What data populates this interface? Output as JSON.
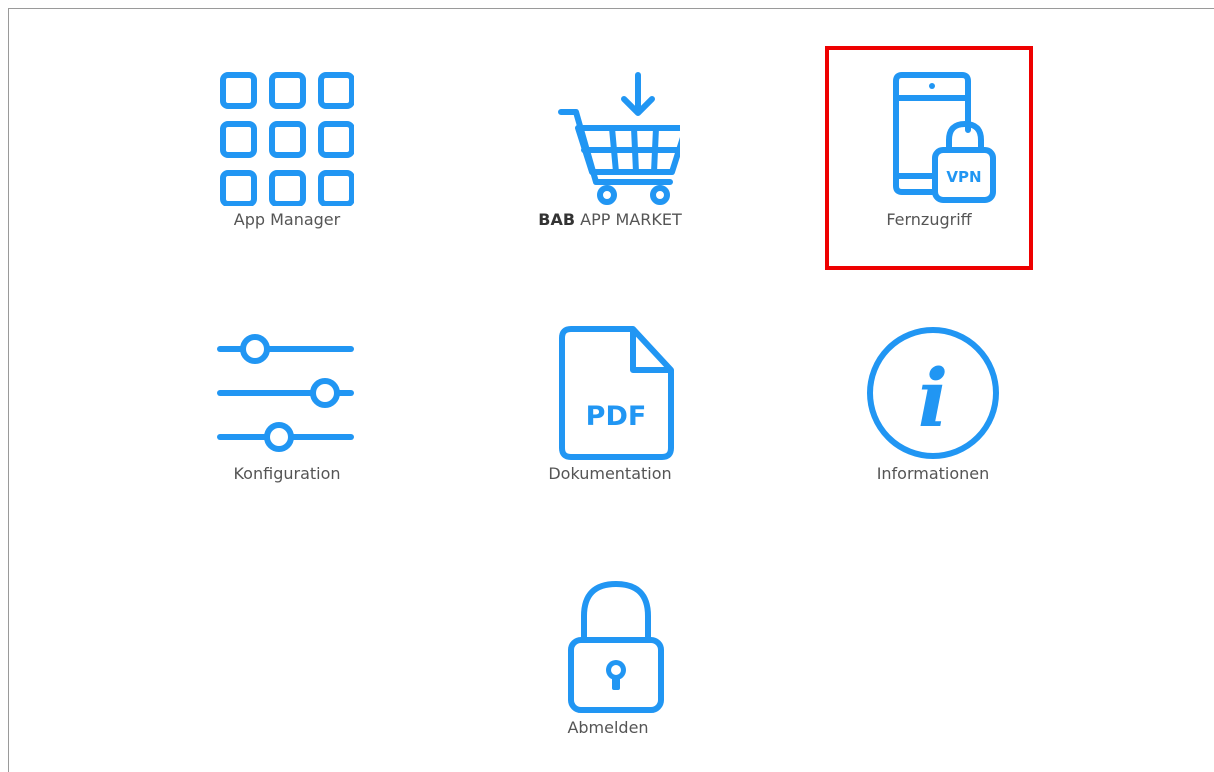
{
  "colors": {
    "icon": "#2196f3",
    "label": "#555555",
    "highlight": "#ee0000"
  },
  "tiles": [
    {
      "label": "App Manager",
      "icon": "grid-icon"
    },
    {
      "label_bold": "BAB",
      "label": "APP MARKET",
      "icon": "shopping-cart-download-icon"
    },
    {
      "label": "Fernzugriff",
      "icon": "phone-vpn-lock-icon",
      "icon_text": "VPN",
      "highlighted": true
    },
    {
      "label": "Konfiguration",
      "icon": "sliders-icon"
    },
    {
      "label": "Dokumentation",
      "icon": "pdf-document-icon",
      "icon_text": "PDF"
    },
    {
      "label": "Informationen",
      "icon": "info-circle-icon",
      "icon_text": "i"
    },
    {
      "label": "Abmelden",
      "icon": "padlock-icon"
    }
  ]
}
